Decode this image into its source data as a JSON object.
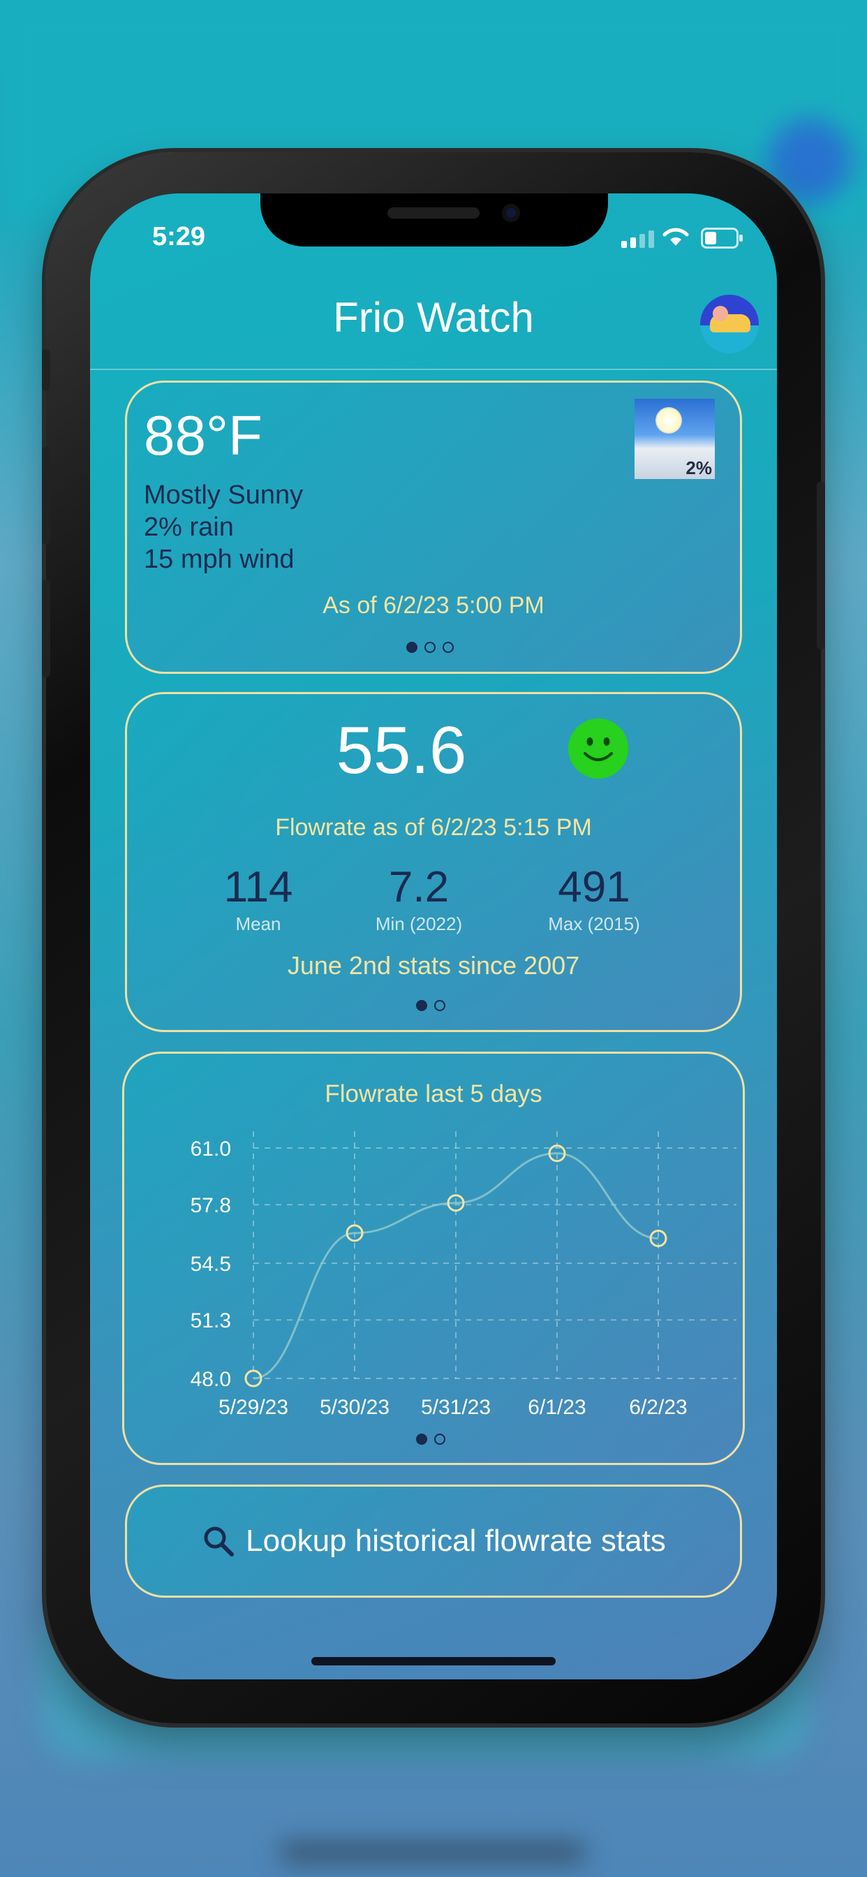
{
  "status_bar": {
    "time": "5:29"
  },
  "app": {
    "title": "Frio Watch"
  },
  "weather": {
    "temperature": "88°F",
    "condition": "Mostly Sunny",
    "rain": "2% rain",
    "wind": "15 mph wind",
    "as_of": "As of 6/2/23 5:00 PM",
    "icon_badge": "2%",
    "icon": "sunny-clouds-icon",
    "page_dots": {
      "total": 3,
      "active": 0
    }
  },
  "flowrate": {
    "current": "55.6",
    "status_icon": "smiley-face-icon",
    "as_of": "Flowrate as of 6/2/23 5:15 PM",
    "stats": [
      {
        "value": "114",
        "label": "Mean"
      },
      {
        "value": "7.2",
        "label": "Min (2022)"
      },
      {
        "value": "491",
        "label": "Max (2015)"
      }
    ],
    "since": "June 2nd stats since 2007",
    "page_dots": {
      "total": 2,
      "active": 0
    }
  },
  "chart_data": {
    "type": "line",
    "title": "Flowrate last 5 days",
    "categories": [
      "5/29/23",
      "5/30/23",
      "5/31/23",
      "6/1/23",
      "6/2/23"
    ],
    "values": [
      48.0,
      56.2,
      57.9,
      60.7,
      55.9
    ],
    "y_ticks": [
      "61.0",
      "57.8",
      "54.5",
      "51.3",
      "48.0"
    ],
    "ylim": [
      48.0,
      61.0
    ],
    "grid": true,
    "page_dots": {
      "total": 2,
      "active": 0
    }
  },
  "lookup_button": {
    "label": "Lookup historical flowrate stats",
    "icon": "search-icon"
  },
  "colors": {
    "accent_text": "#f5e5a2",
    "card_border": "#efe0a5",
    "dark_text": "#1a2a50",
    "smiley": "#27d11d"
  }
}
